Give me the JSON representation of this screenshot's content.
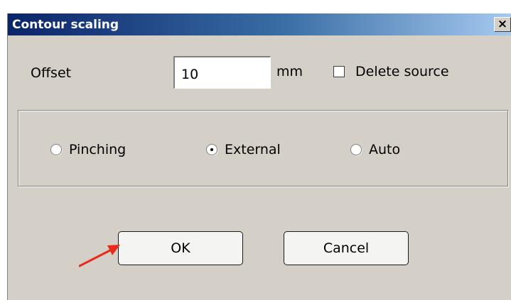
{
  "dialog": {
    "title": "Contour scaling",
    "close_glyph": "×"
  },
  "offset": {
    "label": "Offset",
    "value": "10",
    "unit": "mm"
  },
  "delete_source": {
    "label": "Delete source",
    "checked": false
  },
  "mode": {
    "options": [
      {
        "label": "Pinching",
        "selected": false
      },
      {
        "label": "External",
        "selected": true
      },
      {
        "label": "Auto",
        "selected": false
      }
    ]
  },
  "buttons": {
    "ok_label": "OK",
    "cancel_label": "Cancel"
  },
  "colors": {
    "title_bar_start": "#0a246a",
    "title_bar_end": "#a6caf0",
    "dialog_bg": "#d4d0c8",
    "annotation_arrow": "#e8291c"
  },
  "annotation": {
    "icon": "red-arrow-icon",
    "points_to": "ok-button"
  }
}
